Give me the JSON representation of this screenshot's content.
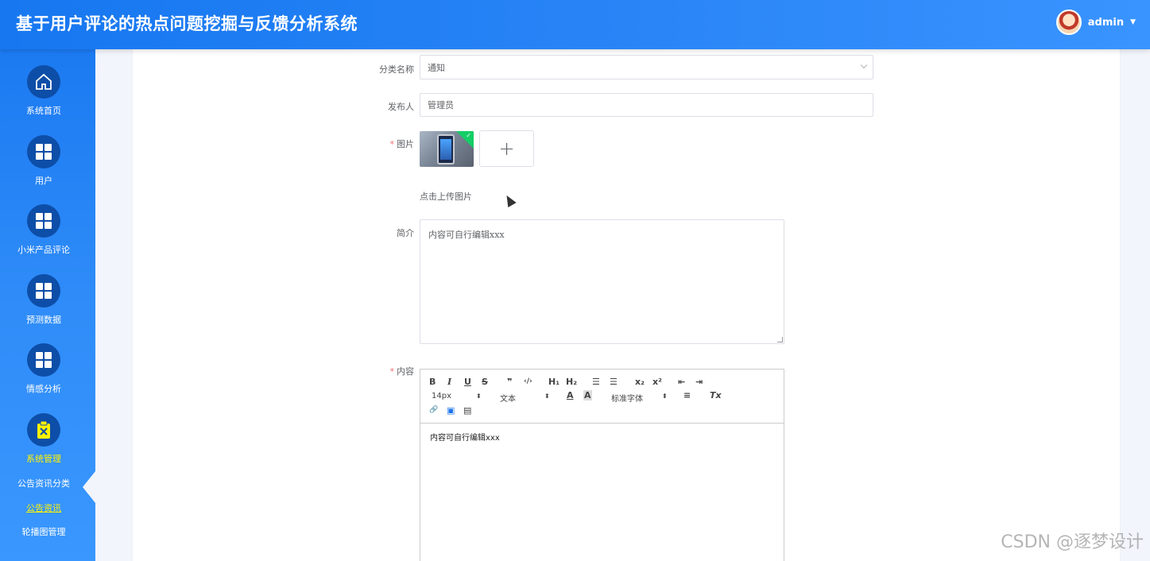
{
  "header": {
    "title": "基于用户评论的热点问题挖掘与反馈分析系统",
    "username": "admin"
  },
  "sidebar": {
    "items": [
      {
        "label": "系统首页",
        "icon": "home-icon"
      },
      {
        "label": "用户",
        "icon": "grid-icon"
      },
      {
        "label": "小米产品评论",
        "icon": "grid-icon"
      },
      {
        "label": "预测数据",
        "icon": "grid-icon"
      },
      {
        "label": "情感分析",
        "icon": "grid-icon"
      },
      {
        "label": "系统管理",
        "icon": "clipboard-icon"
      }
    ],
    "sub_items": [
      {
        "label": "公告资讯分类"
      },
      {
        "label": "公告资讯"
      },
      {
        "label": "轮播图管理"
      }
    ]
  },
  "form": {
    "category_label": "分类名称",
    "category_value": "通知",
    "publisher_label": "发布人",
    "publisher_value": "管理员",
    "image_label": "图片",
    "upload_plus": "+",
    "upload_hint": "点击上传图片",
    "summary_label": "简介",
    "summary_value": "内容可自行编辑xxx",
    "content_label": "内容"
  },
  "editor": {
    "buttons": {
      "bold": "B",
      "italic": "I",
      "underline": "U",
      "strike": "S",
      "quote": "❞",
      "code": "‹/›",
      "h1": "H₁",
      "h2": "H₂",
      "ordered": "☰",
      "bullet": "☰",
      "sub": "x₂",
      "sup": "x²",
      "outdent": "⇤",
      "indent": "⇥",
      "align": "≡",
      "clean": "Tx",
      "link": "🔗",
      "image": "▣",
      "video": "▤"
    },
    "size_value": "14px",
    "header_value": "文本",
    "font_value": "标准字体",
    "body": "内容可自行编辑xxx"
  },
  "watermark": "CSDN @逐梦设计",
  "colors": {
    "header_blue": "#1677f0",
    "sidebar_circle": "#0d4ea8",
    "active_yellow": "#fff200",
    "required_red": "#f56c6c"
  }
}
